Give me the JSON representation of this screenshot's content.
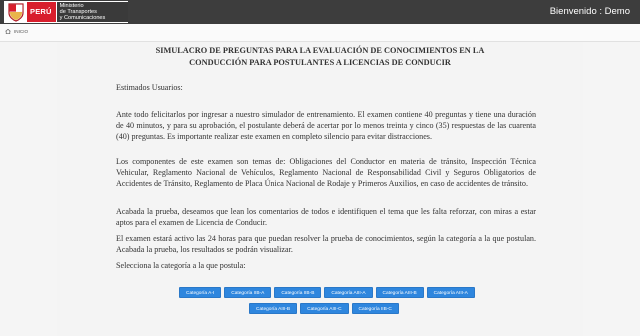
{
  "header": {
    "peru_label": "PERÚ",
    "ministry_line1": "Ministerio",
    "ministry_line2": "de Transportes",
    "ministry_line3": "y Comunicaciones",
    "welcome": "Bienvenido : Demo"
  },
  "breadcrumb": {
    "home_label": "INICIO"
  },
  "main": {
    "title_line1": "SIMULACRO DE PREGUNTAS PARA LA EVALUACIÓN DE CONOCIMIENTOS EN LA",
    "title_line2": "CONDUCCIÓN PARA POSTULANTES A LICENCIAS DE CONDUCIR",
    "greeting": "Estimados Usuarios:",
    "paragraph1": "Ante todo felicitarlos por ingresar a nuestro simulador de entrenamiento. El examen contiene 40 preguntas y tiene una duración de 40 minutos, y para su aprobación, el postulante deberá de acertar por lo menos treinta y cinco (35) respuestas de las cuarenta (40) preguntas. Es importante realizar este examen en completo silencio para evitar distracciones.",
    "paragraph2": "Los componentes de este examen son temas de: Obligaciones del Conductor en materia de tránsito, Inspección Técnica Vehicular, Reglamento Nacional de Vehículos, Reglamento Nacional de Responsabilidad Civil y Seguros Obligatorios de Accidentes de Tránsito, Reglamento de Placa Única Nacional de Rodaje y Primeros Auxilios, en caso de accidentes de tránsito.",
    "paragraph3": "Acabada la prueba, deseamos que lean los comentarios de todos e identifiquen el tema que les falta reforzar, con miras a estar aptos para el examen de Licencia de Conducir.",
    "paragraph4": "El examen estará activo las 24 horas para que puedan resolver la prueba de conocimientos, según la categoría a la que postulan. Acabada la prueba, los resultados se podrán visualizar.",
    "prompt": "Selecciona la categoría a la que postula:"
  },
  "categories_row1": [
    "Categoría A-I",
    "Categoría IIB-A",
    "Categoría IIB-B",
    "Categoría AIII-A",
    "Categoría AIII-B",
    "Categoría AIII-A"
  ],
  "categories_row2": [
    "Categoría AIII-B",
    "Categoría AIII-C",
    "Categoría IIB-C"
  ],
  "colors": {
    "header_bg": "#3d3d3d",
    "peru_red": "#d81e2c",
    "button_blue": "#2e86de",
    "page_bg": "#f4f4f4"
  },
  "icons": {
    "brand": "peru-shield-icon",
    "home": "home-icon"
  }
}
